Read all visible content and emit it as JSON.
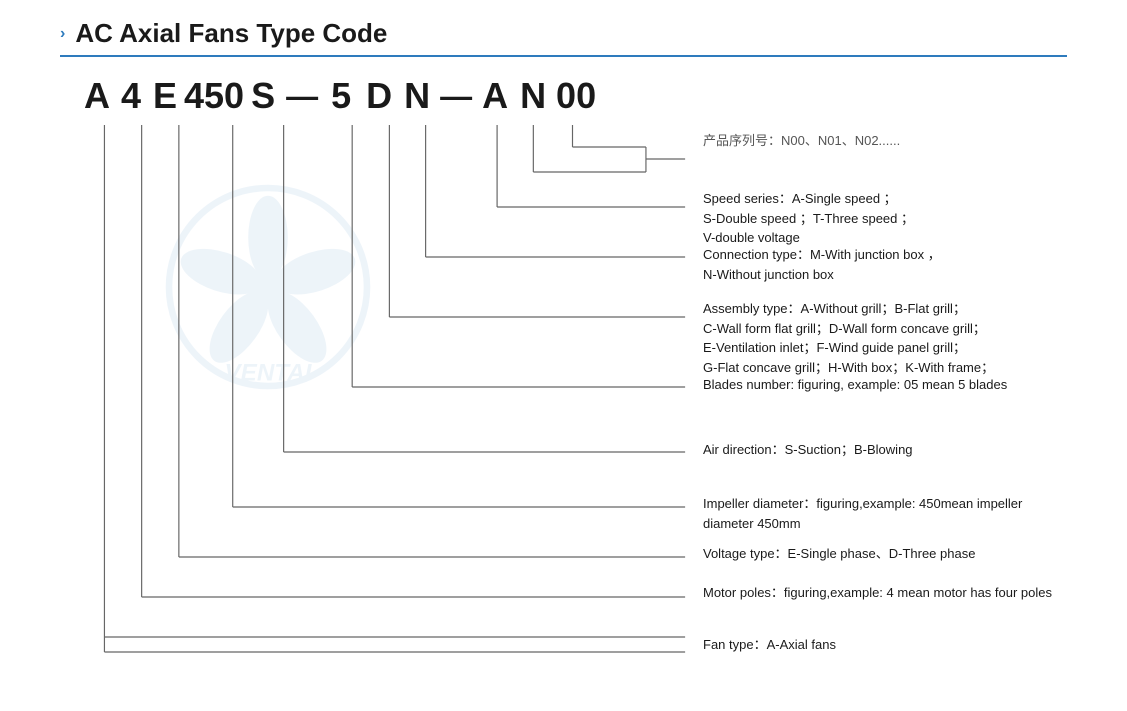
{
  "title": {
    "chevron": "›",
    "text": "AC Axial Fans Type Code"
  },
  "code_sequence": [
    "A",
    "4",
    "E",
    "450",
    "S",
    "—",
    "5",
    "D",
    "N",
    "—",
    "A",
    "N",
    "00"
  ],
  "labels": [
    {
      "id": "product-series",
      "line1": "产品序列号：N00、N01、N02......",
      "line2": ""
    },
    {
      "id": "speed-series",
      "line1": "Speed series：A-Single speed ；",
      "line2": "S-Double speed ；T-Three speed ；",
      "line3": "V-double voltage"
    },
    {
      "id": "connection-type",
      "line1": "Connection type：M-With junction box ，",
      "line2": "N-Without junction box"
    },
    {
      "id": "assembly-type",
      "line1": "Assembly type：A-Without grill；B-Flat grill；",
      "line2": "C-Wall form flat grill；D-Wall form concave grill；",
      "line3": "E-Ventilation inlet；F-Wind guide panel grill；",
      "line4": "G-Flat concave grill；H-With box；K-With frame；"
    },
    {
      "id": "blades-number",
      "line1": "Blades number: figuring, example: 05 mean 5 blades"
    },
    {
      "id": "air-direction",
      "line1": "Air direction：S-Suction；B-Blowing"
    },
    {
      "id": "impeller-diameter",
      "line1": "Impeller diameter：figuring,example: 450mean impeller diameter 450mm"
    },
    {
      "id": "voltage-type",
      "line1": "Voltage type：E-Single phase、D-Three phase"
    },
    {
      "id": "motor-poles",
      "line1": "Motor poles：figuring,example: 4 mean motor has four poles"
    },
    {
      "id": "fan-type",
      "line1": "Fan type：A-Axial fans"
    }
  ]
}
